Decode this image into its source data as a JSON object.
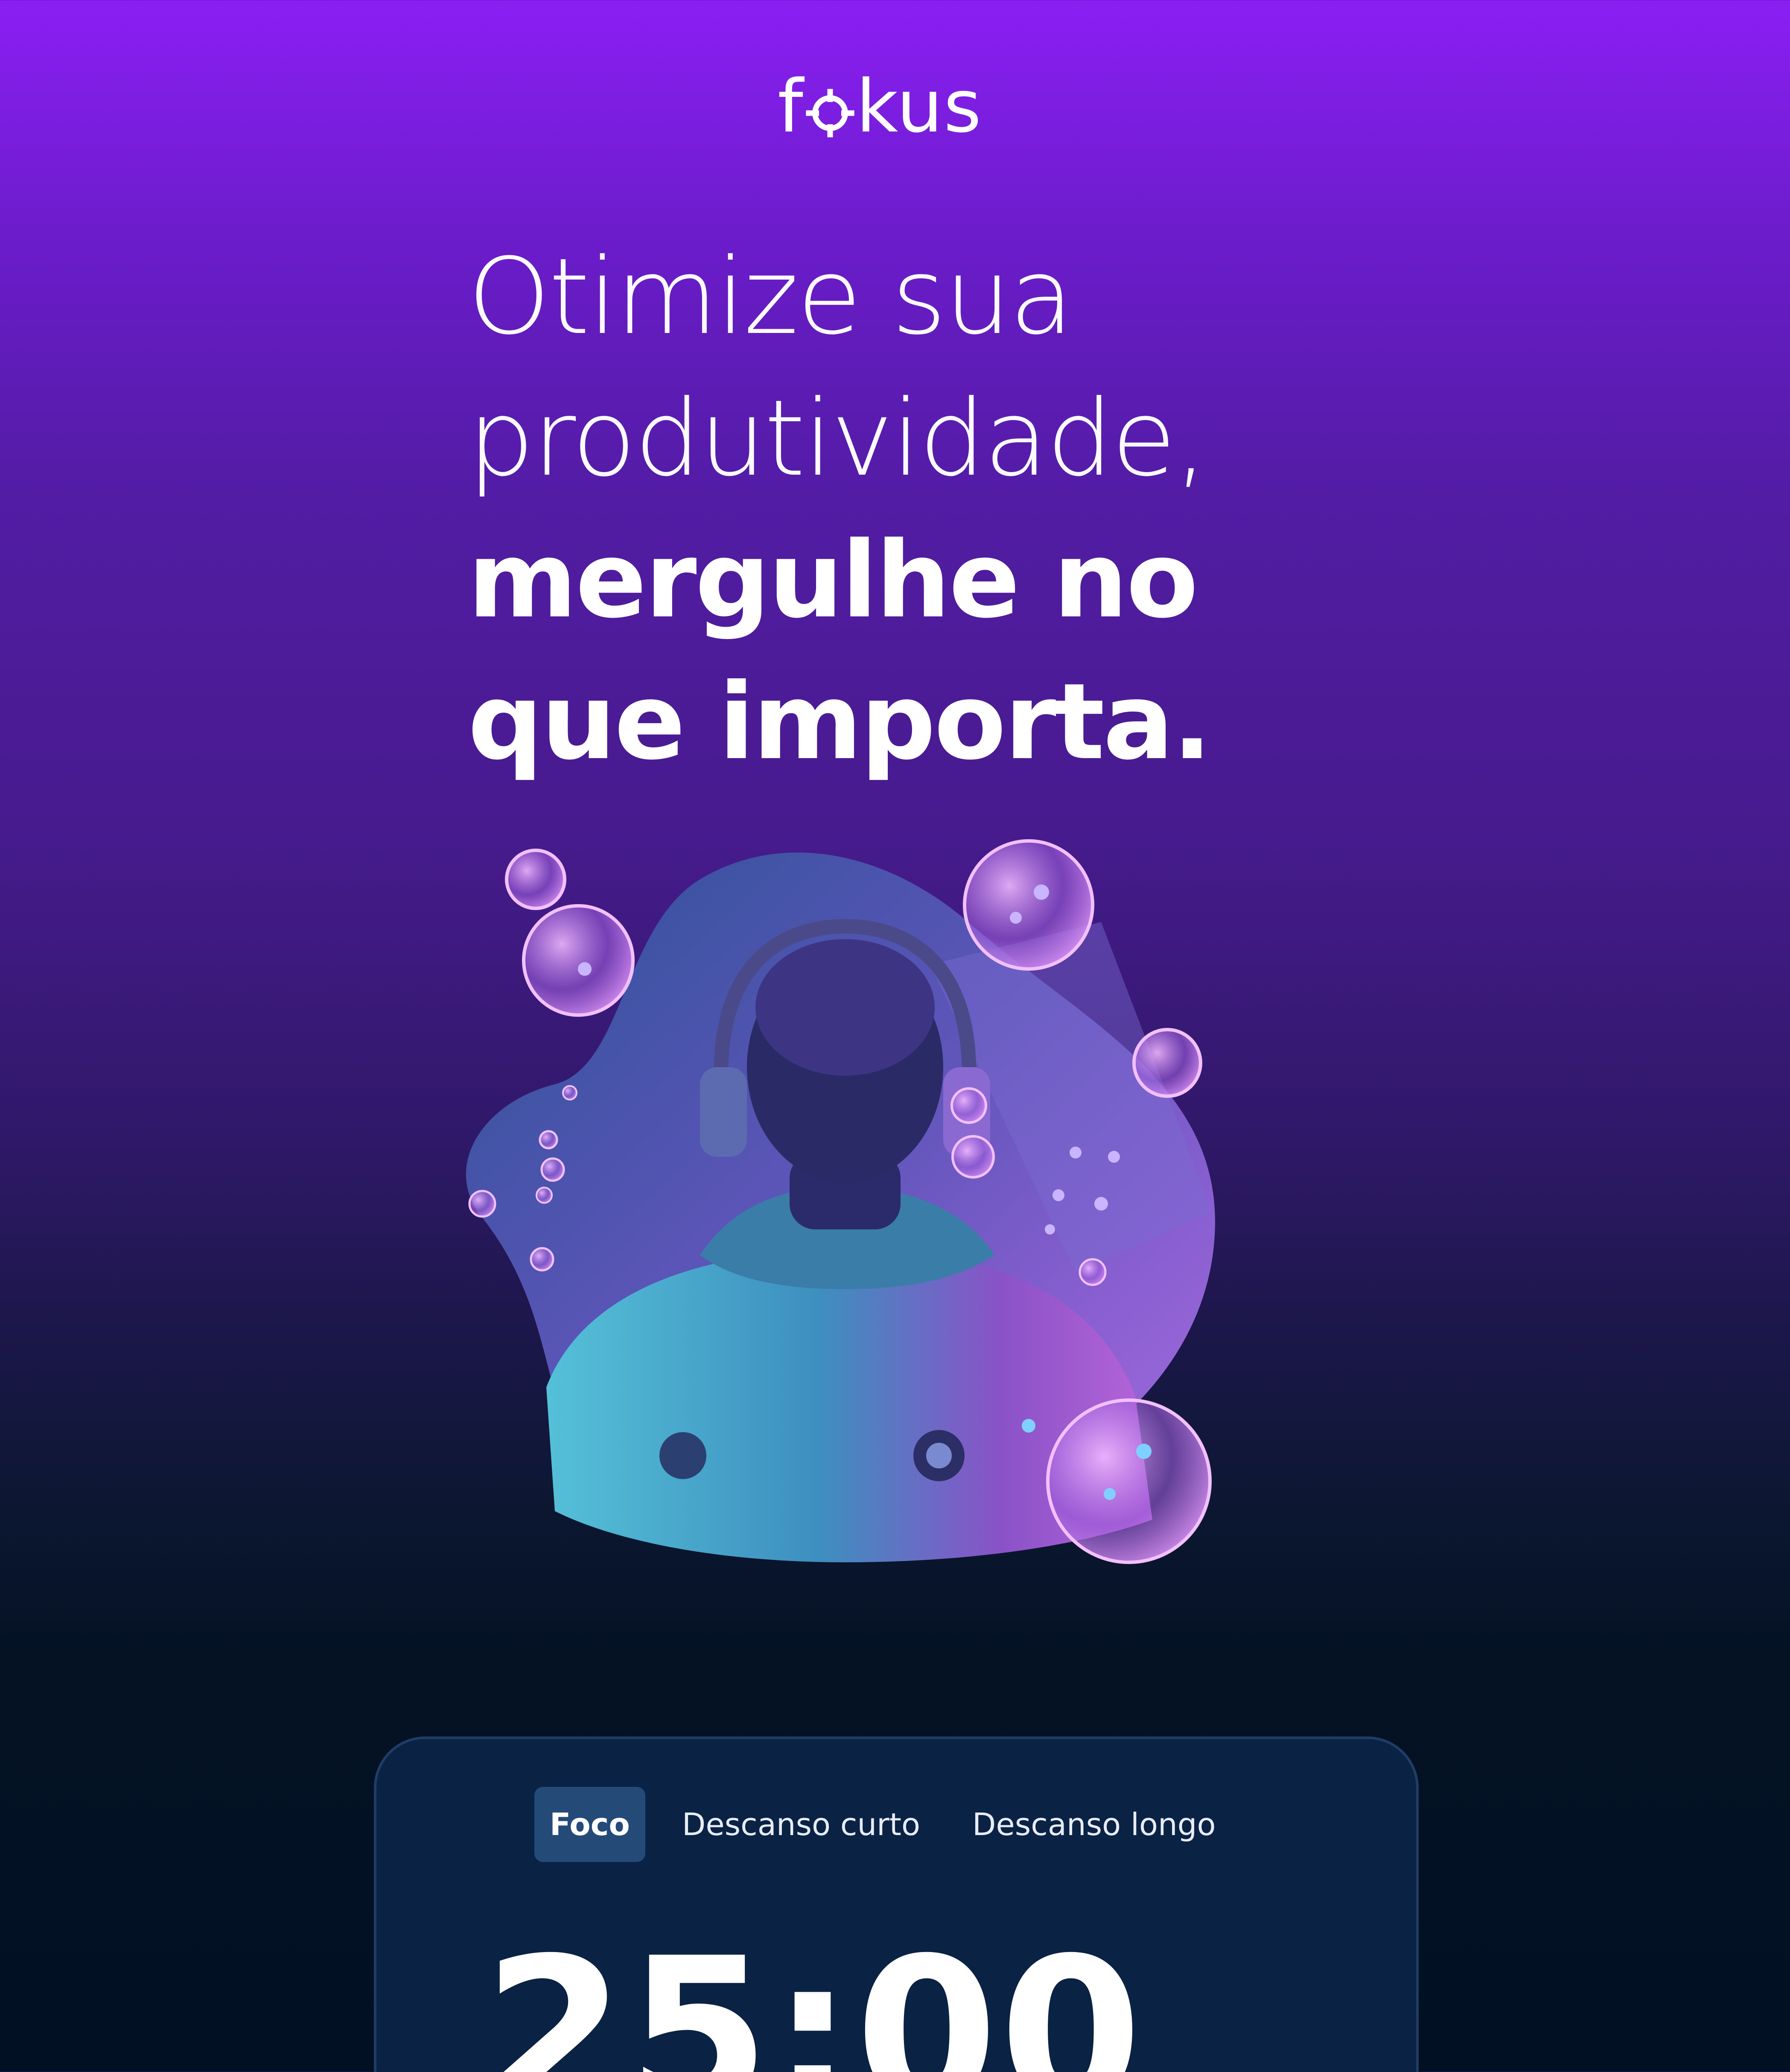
{
  "app": {
    "logo_text_prefix": "f",
    "logo_text_suffix": "kus"
  },
  "hero": {
    "headline_light_line1": "Otimize sua",
    "headline_light_line2": "produtividade,",
    "headline_bold_line1": "mergulhe no",
    "headline_bold_line2": "que importa.",
    "illustration": "diver-with-headphones-and-bubbles"
  },
  "timer_card": {
    "tabs": [
      {
        "label": "Foco",
        "active": true
      },
      {
        "label": "Descanso curto",
        "active": false
      },
      {
        "label": "Descanso longo",
        "active": false
      }
    ],
    "time": "25:00"
  },
  "colors": {
    "gradient_top": "#8b1ff3",
    "gradient_bottom": "#021024",
    "card_bg": "#0a2244",
    "active_tab_bg": "#244a78"
  }
}
